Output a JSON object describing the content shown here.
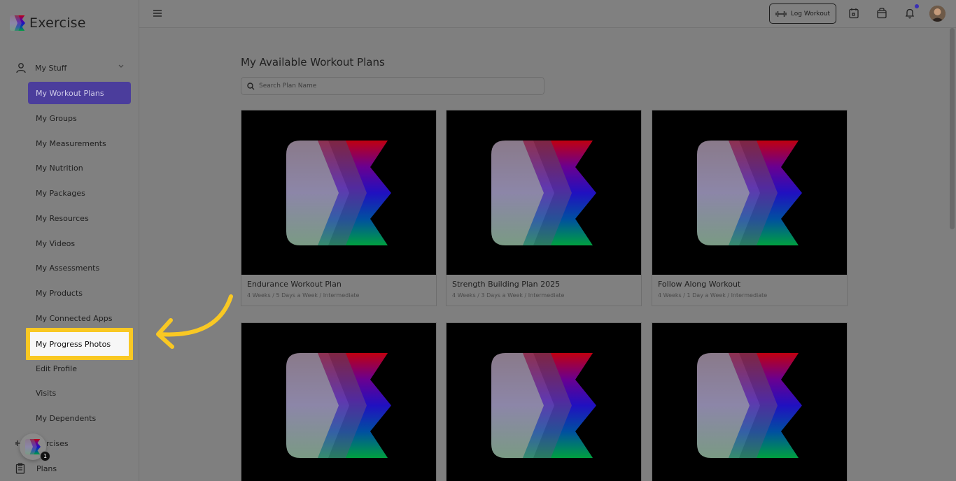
{
  "app": {
    "name": "Exercise"
  },
  "sidebar": {
    "section": "My Stuff",
    "items": [
      {
        "label": "My Workout Plans",
        "state": "active"
      },
      {
        "label": "My Groups"
      },
      {
        "label": "My Measurements"
      },
      {
        "label": "My Nutrition"
      },
      {
        "label": "My Packages"
      },
      {
        "label": "My Resources"
      },
      {
        "label": "My Videos"
      },
      {
        "label": "My Assessments"
      },
      {
        "label": "My Products"
      },
      {
        "label": "My Connected Apps"
      },
      {
        "label": "My Progress Photos",
        "state": "highlighted"
      },
      {
        "label": "Edit Profile"
      },
      {
        "label": "Visits"
      },
      {
        "label": "My Dependents"
      }
    ],
    "bottom": [
      {
        "label": "rcises",
        "icon": "dumbbell-icon"
      },
      {
        "label": "Plans",
        "icon": "clipboard-icon"
      }
    ],
    "chat_badge": "1"
  },
  "topbar": {
    "log_workout_label": "Log Workout",
    "icons": [
      "calendar-icon",
      "shopping-bag-icon",
      "bell-icon",
      "avatar"
    ]
  },
  "main": {
    "title": "My Available Workout Plans",
    "search_placeholder": "Search Plan Name",
    "plans": [
      {
        "title": "Endurance Workout Plan",
        "subtitle": "4 Weeks / 5 Days a Week / Intermediate"
      },
      {
        "title": "Strength Building Plan 2025",
        "subtitle": "4 Weeks / 3 Days a Week / Intermediate"
      },
      {
        "title": "Follow Along Workout",
        "subtitle": "4 Weeks / 1 Day a Week / Intermediate"
      },
      {
        "title": "",
        "subtitle": ""
      },
      {
        "title": "",
        "subtitle": ""
      },
      {
        "title": "",
        "subtitle": ""
      }
    ]
  },
  "colors": {
    "active_nav": "#4b3d9c",
    "highlight": "#f9c823",
    "overlay_bg": "#808080"
  }
}
